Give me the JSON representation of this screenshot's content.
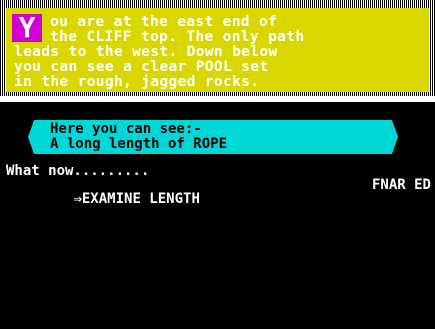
{
  "room": {
    "dropcap": "Y",
    "lines": [
      "ou are at the east end of",
      "the CLIFF top. The only path",
      "leads to the west. Down below",
      "you can see a clear POOL set",
      "in the rough, jagged rocks."
    ]
  },
  "objects": {
    "heading": "Here you can see:-",
    "items": [
      "A long length of ROPE"
    ]
  },
  "prompt": {
    "question": "What now.........",
    "arrow": "⇒",
    "command": "EXAMINE LENGTH",
    "response": "FNAR ED"
  },
  "colors": {
    "description_bg": "#d8d800",
    "dropcap_bg": "#d000d0",
    "objects_bg": "#00d8d8",
    "screen_bg": "#000000"
  }
}
